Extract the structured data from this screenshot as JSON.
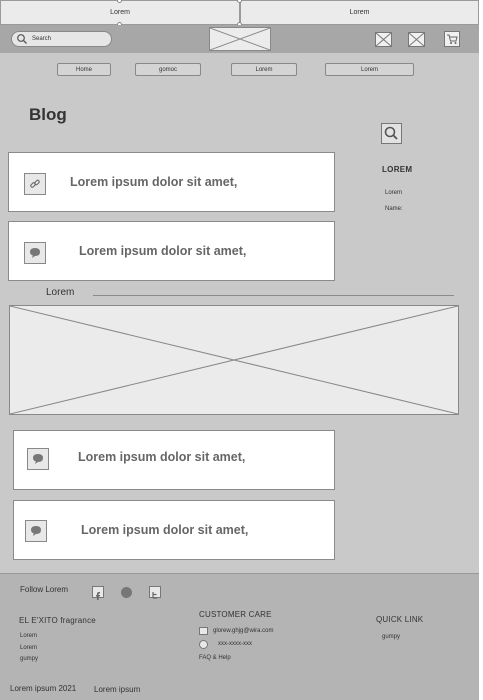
{
  "top_tabs": [
    "Lorem",
    "Lorem"
  ],
  "header": {
    "search_placeholder": "Search",
    "icons": [
      "mail-icon",
      "mail-icon",
      "cart-icon"
    ]
  },
  "nav": [
    "Home",
    "gomoc",
    "Lorem",
    "Lorem"
  ],
  "page_title": "Blog",
  "sidebar": {
    "heading": "LOREM",
    "items": [
      "Lorem",
      "Name:"
    ]
  },
  "cards_top": [
    {
      "icon": "link-icon",
      "text": "Lorem ipsum dolor sit amet,"
    },
    {
      "icon": "chat-icon",
      "text": "Lorem ipsum dolor sit amet,"
    }
  ],
  "section_label": "Lorem",
  "cards_bottom": [
    {
      "icon": "chat-icon",
      "text": "Lorem ipsum dolor sit amet,"
    },
    {
      "icon": "chat-icon",
      "text": "Lorem ipsum dolor sit amet,"
    }
  ],
  "footer": {
    "follow_label": "Follow Lorem",
    "brand": {
      "heading": "EL E'XITO fragrance",
      "items": [
        "Lorem",
        "Lorem",
        "gumpy"
      ]
    },
    "care": {
      "heading": "CUSTOMER CARE",
      "email": "glorew.ghjg@wira.com",
      "phone": "xxx-xxxx-xxx",
      "faq": "FAQ & Help"
    },
    "quick": {
      "heading": "QUICK LINK",
      "items": [
        "gumpy"
      ]
    },
    "copyright": "Lorem ipsum 2021",
    "extra": "Lorem ipsum"
  }
}
